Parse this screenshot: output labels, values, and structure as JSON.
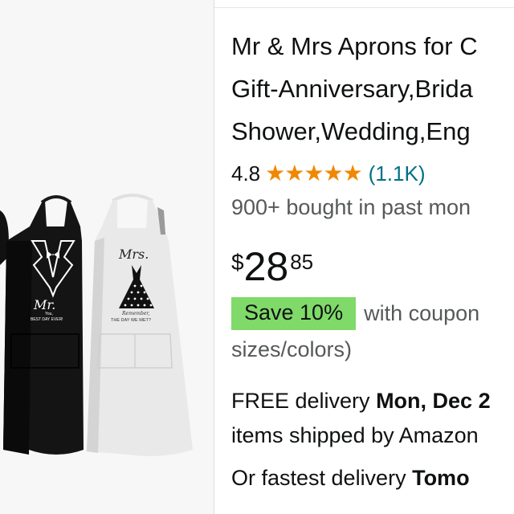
{
  "product": {
    "title_lines": [
      "Mr & Mrs Aprons for C",
      "Gift-Anniversary,Brida",
      "Shower,Wedding,Eng"
    ],
    "rating": "4.8",
    "stars": "★★★★★",
    "review_count": "(1.1K)",
    "bought": "900+ bought in past mon",
    "price": {
      "currency": "$",
      "whole": "28",
      "fraction": "85"
    },
    "coupon": {
      "badge": "Save 10%",
      "text": "with coupon"
    },
    "sizes_note": "sizes/colors)",
    "delivery": {
      "prefix": "FREE delivery ",
      "date": "Mon, Dec 2"
    },
    "items_line": "items shipped by Amazon",
    "fastest": {
      "prefix": "Or fastest delivery ",
      "date": "Tomo"
    }
  },
  "image": {
    "mr_text": "Mr.",
    "mr_sub1": "You,",
    "mr_sub2": "BEST DAY EVER!",
    "mrs_text": "Mrs.",
    "mrs_sub1": "Remember,",
    "mrs_sub2": "THE DAY WE MET?"
  }
}
